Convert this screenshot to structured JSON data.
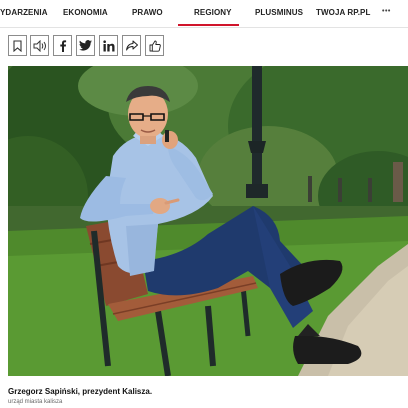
{
  "nav": {
    "items": [
      {
        "label": "YDARZENIA"
      },
      {
        "label": "EKONOMIA"
      },
      {
        "label": "PRAWO"
      },
      {
        "label": "REGIONY"
      },
      {
        "label": "PLUSMINUS"
      },
      {
        "label": "TWOJA RP.PL"
      }
    ],
    "more_label": "•••",
    "active": "REGIONY",
    "accent_color": "#d0142b"
  },
  "share_bar": {
    "buttons": [
      "bookmark-icon",
      "audio-icon",
      "facebook-icon",
      "twitter-icon",
      "linkedin-icon",
      "share-arrow-icon",
      "thumbs-up-icon"
    ]
  },
  "article": {
    "caption": "Grzegorz Sapiński, prezydent Kalisza.",
    "credit": "urząd miasta kalisza"
  }
}
